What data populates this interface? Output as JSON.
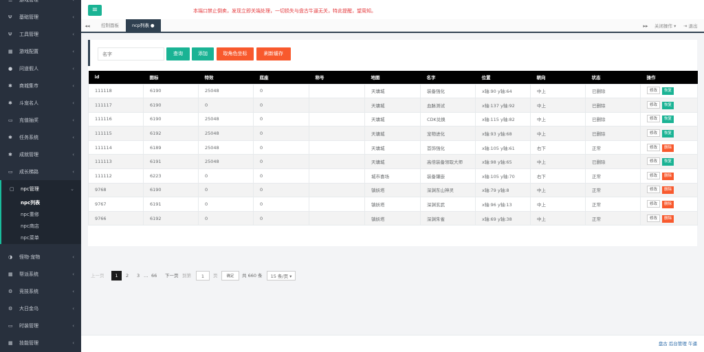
{
  "sidebar": {
    "items": [
      {
        "label": "游戏管理",
        "icon": "gamepad-icon",
        "glyph": "☰"
      },
      {
        "label": "基础管理",
        "icon": "cutlery-icon",
        "glyph": "Ψ"
      },
      {
        "label": "工具管理",
        "icon": "tools-icon",
        "glyph": "Ψ"
      },
      {
        "label": "游戏配置",
        "icon": "grid-icon",
        "glyph": "▦"
      },
      {
        "label": "问道假人",
        "icon": "user-icon",
        "glyph": "●"
      },
      {
        "label": "商城集市",
        "icon": "gear-icon",
        "glyph": "✱"
      },
      {
        "label": "斗宠名人",
        "icon": "asterisk-icon",
        "glyph": "✱"
      },
      {
        "label": "充值抽奖",
        "icon": "ticket-icon",
        "glyph": "▭"
      },
      {
        "label": "任务系统",
        "icon": "gear-icon",
        "glyph": "✱"
      },
      {
        "label": "成就管理",
        "icon": "gear-icon",
        "glyph": "✱"
      },
      {
        "label": "成长梯路",
        "icon": "ticket-icon",
        "glyph": "▭"
      }
    ],
    "active": {
      "label": "npc管理",
      "icon": "square-icon",
      "glyph": "▢"
    },
    "subitems": [
      "npc列表",
      "npc重修",
      "npc商店",
      "npc菜单"
    ],
    "items_after": [
      {
        "label": "怪物·宠物",
        "icon": "half-circle-icon",
        "glyph": "◑"
      },
      {
        "label": "帮派系统",
        "icon": "grid-icon",
        "glyph": "▦"
      },
      {
        "label": "竞技系统",
        "icon": "cogs-icon",
        "glyph": "⚙"
      },
      {
        "label": "大日金乌",
        "icon": "cogs-icon",
        "glyph": "⚙"
      },
      {
        "label": "时装管理",
        "icon": "ticket-icon",
        "glyph": "▭"
      },
      {
        "label": "技能管理",
        "icon": "grid-icon",
        "glyph": "▦"
      }
    ]
  },
  "topbar": {
    "menu_icon": "hamburger-icon",
    "notice": "本端口禁止倒卖，发现立即关端处理，一切损失与盘古牛逼无关，特此提醒，望周知。"
  },
  "tabs": {
    "items": [
      "控制面板",
      "ncp列表 ●"
    ],
    "close_label": "关闭操作 ▾",
    "logout_label": "⇥ 退出"
  },
  "search": {
    "placeholder": "名字",
    "query_label": "查询",
    "add_label": "添加",
    "coords_label": "取角色坐标",
    "refresh_label": "刷新缓存"
  },
  "table": {
    "headers": [
      "id",
      "图标",
      "特效",
      "底座",
      "称号",
      "地图",
      "名字",
      "位置",
      "朝向",
      "状态",
      "操作"
    ],
    "rows": [
      {
        "cells": [
          "111118",
          "6190",
          "25048",
          "0",
          "",
          "天墉城",
          "装备强化",
          "x轴:90 y轴:64",
          "中上",
          "已删除"
        ],
        "action": "恢复"
      },
      {
        "cells": [
          "111117",
          "6190",
          "0",
          "0",
          "",
          "天墉城",
          "血脉测试",
          "x轴:137 y轴:92",
          "中上",
          "已删除"
        ],
        "action": "恢复"
      },
      {
        "cells": [
          "111116",
          "6190",
          "25048",
          "0",
          "",
          "天墉城",
          "CDK兑换",
          "x轴:115 y轴:82",
          "中上",
          "已删除"
        ],
        "action": "恢复"
      },
      {
        "cells": [
          "111115",
          "6192",
          "25048",
          "0",
          "",
          "天墉城",
          "宠物进化",
          "x轴:93 y轴:68",
          "中上",
          "已删除"
        ],
        "action": "恢复"
      },
      {
        "cells": [
          "111114",
          "6189",
          "25048",
          "0",
          "",
          "天墉城",
          "首饰强化",
          "x轴:105 y轴:61",
          "右下",
          "正常"
        ],
        "action": "删除"
      },
      {
        "cells": [
          "111113",
          "6191",
          "25048",
          "0",
          "",
          "天墉城",
          "高倍装备领取大师",
          "x轴:98 y轴:65",
          "中上",
          "已删除"
        ],
        "action": "恢复"
      },
      {
        "cells": [
          "111112",
          "6223",
          "0",
          "0",
          "",
          "城市喜场",
          "装备镶嵌",
          "x轴:105 y轴:70",
          "右下",
          "正常"
        ],
        "action": "删除"
      },
      {
        "cells": [
          "9768",
          "6190",
          "0",
          "0",
          "",
          "镇妖塔",
          "深渊东山神灵",
          "x轴:79 y轴:8",
          "中上",
          "正常"
        ],
        "action": "删除"
      },
      {
        "cells": [
          "9767",
          "6191",
          "0",
          "0",
          "",
          "镇妖塔",
          "深渊玄武",
          "x轴:96 y轴:13",
          "中上",
          "正常"
        ],
        "action": "删除"
      },
      {
        "cells": [
          "9766",
          "6192",
          "0",
          "0",
          "",
          "镇妖塔",
          "深渊朱雀",
          "x轴:69 y轴:38",
          "中上",
          "正常"
        ],
        "action": "删除"
      }
    ],
    "edit_label": "修改"
  },
  "pager": {
    "prev": "上一页",
    "pages": [
      "1",
      "2",
      "3"
    ],
    "ellipsis": "…",
    "last": "66",
    "next": "下一页",
    "goto": "到第",
    "page_input": "1",
    "page_unit": "页",
    "confirm": "确定",
    "total": "共 660 条",
    "per_page": "15 条/页"
  },
  "footer": {
    "text": "盘古 后台管理 午逼"
  },
  "colors": {
    "teal": "#1ab394",
    "orange": "#f8592d",
    "sidebar": "#28303d",
    "notice": "#e4393c"
  }
}
